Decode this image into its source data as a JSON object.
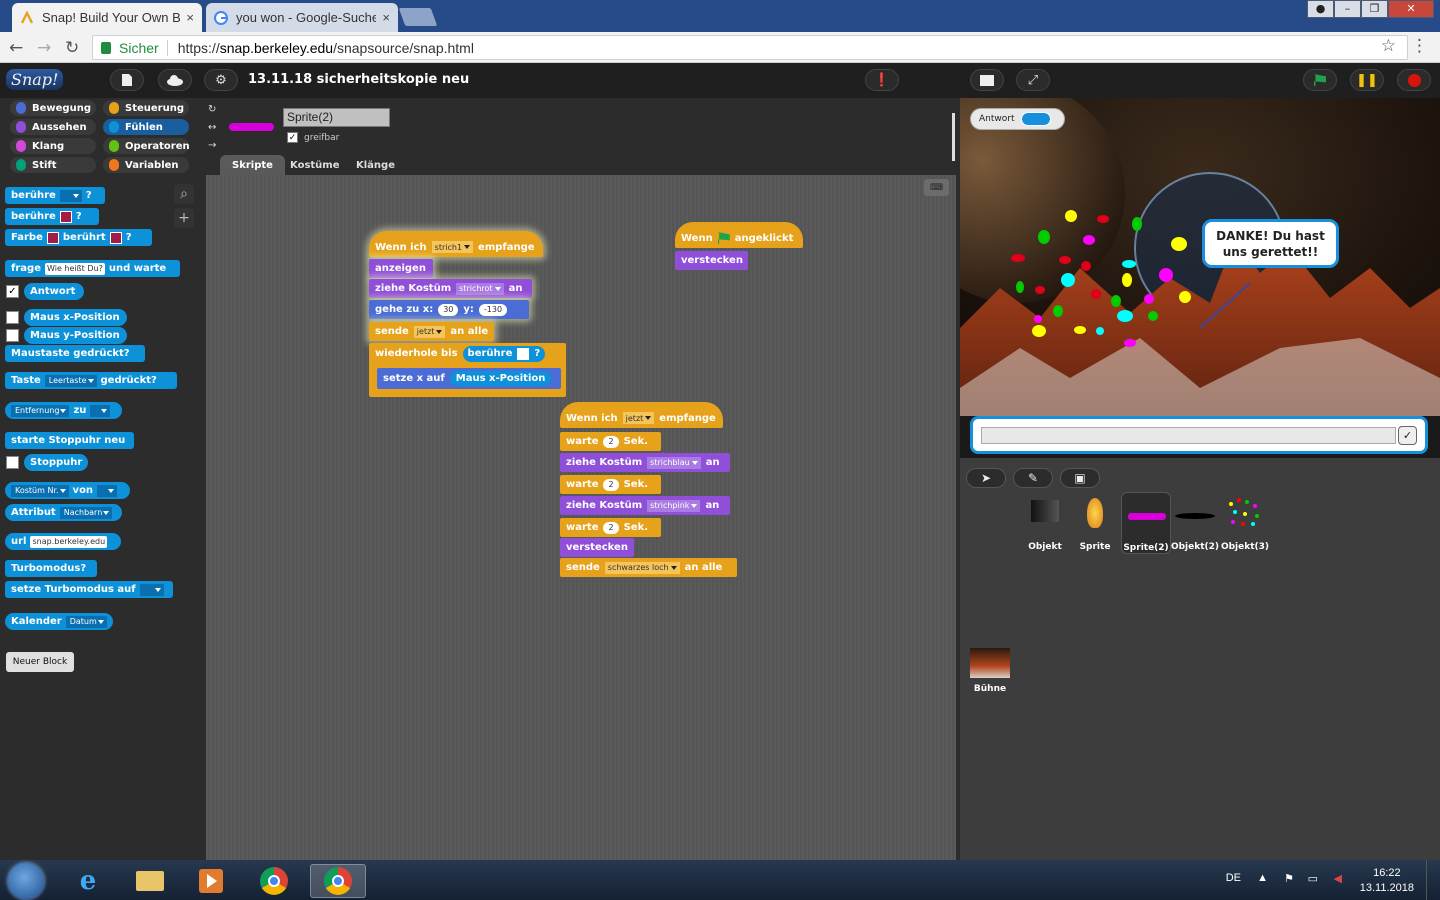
{
  "browser": {
    "tabs": [
      {
        "title": "Snap! Build Your Own Blc",
        "close": "×"
      },
      {
        "title": "you won - Google-Suche",
        "close": "×"
      }
    ],
    "secure_label": "Sicher",
    "url_scheme": "https://",
    "url_host": "snap.berkeley.edu",
    "url_path": "/snapsource/snap.html",
    "star": "☆",
    "menu": "⋮",
    "back": "←",
    "forward": "→",
    "reload": "↻"
  },
  "snap": {
    "logo": "Snap!",
    "project_name": "13.11.18 sicherheitskopie neu",
    "categories": [
      {
        "label": "Bewegung",
        "color": "#4a6cd4"
      },
      {
        "label": "Steuerung",
        "color": "#e6a21b"
      },
      {
        "label": "Aussehen",
        "color": "#8f4fd9"
      },
      {
        "label": "Fühlen",
        "color": "#0d91d8"
      },
      {
        "label": "Klang",
        "color": "#cf4ad9"
      },
      {
        "label": "Operatoren",
        "color": "#62c213"
      },
      {
        "label": "Stift",
        "color": "#00a178"
      },
      {
        "label": "Variablen",
        "color": "#f3761d"
      }
    ],
    "palette": {
      "beruehre": "berühre",
      "q": "?",
      "farbe": "Farbe",
      "beruehrt": "berührt",
      "frage": "frage",
      "frage_default": "Wie heißt Du?",
      "und_warte": "und warte",
      "antwort": "Antwort",
      "maus_x": "Maus x-Position",
      "maus_y": "Maus y-Position",
      "maustaste": "Maustaste gedrückt?",
      "taste": "Taste",
      "leertaste": "Leertaste",
      "gedrueckt": "gedrückt?",
      "entfernung": "Entfernung",
      "zu": "zu",
      "starte_stoppuhr": "starte Stoppuhr neu",
      "stoppuhr": "Stoppuhr",
      "kostuem_nr": "Kostüm Nr.",
      "von": "von",
      "attribut": "Attribut",
      "nachbarn": "Nachbarn",
      "url": "url",
      "url_default": "snap.berkeley.edu",
      "turbomodus": "Turbomodus?",
      "setze_turbo": "setze Turbomodus auf",
      "kalender": "Kalender",
      "datum": "Datum",
      "neuer_block": "Neuer Block"
    },
    "sprite": {
      "name": "Sprite(2)",
      "greifbar": "greifbar",
      "tabs": [
        "Skripte",
        "Kostüme",
        "Klänge"
      ]
    },
    "scripts": {
      "s1": {
        "wenn_ich": "Wenn ich",
        "msg": "strich1",
        "empfange": "empfange",
        "anzeigen": "anzeigen",
        "ziehe_kostuem": "ziehe Kostüm",
        "kostuem": "strichrot",
        "an": "an",
        "gehe_zu_x": "gehe zu x:",
        "x": "30",
        "y_label": "y:",
        "y": "-130",
        "sende": "sende",
        "sende_msg": "jetzt",
        "an_alle": "an alle",
        "wiederhole_bis": "wiederhole bis",
        "beruehre": "berühre",
        "q": "?",
        "setze_x_auf": "setze x auf",
        "maus_x": "Maus x-Position"
      },
      "s2": {
        "wenn": "Wenn",
        "angeklickt": "angeklickt",
        "verstecken": "verstecken"
      },
      "s3": {
        "wenn_ich": "Wenn ich",
        "msg": "jetzt",
        "empfange": "empfange",
        "warte": "warte",
        "two": "2",
        "sek": "Sek.",
        "ziehe_kostuem": "ziehe Kostüm",
        "k1": "strichblau",
        "k2": "strichpink",
        "an": "an",
        "verstecken": "verstecken",
        "sende": "sende",
        "sende_msg": "schwarzes loch",
        "an_alle": "an alle"
      }
    },
    "stage": {
      "watcher_label": "Antwort",
      "bubble": "DANKE! Du hast uns gerettet!!",
      "ok": "✓"
    },
    "corral": {
      "sprites": [
        {
          "name": "Objekt"
        },
        {
          "name": "Sprite"
        },
        {
          "name": "Sprite(2)"
        },
        {
          "name": "Objekt(2)"
        },
        {
          "name": "Objekt(3)"
        }
      ],
      "stage_label": "Bühne"
    }
  },
  "taskbar": {
    "lang": "DE",
    "time": "16:22",
    "date": "13.11.2018"
  }
}
